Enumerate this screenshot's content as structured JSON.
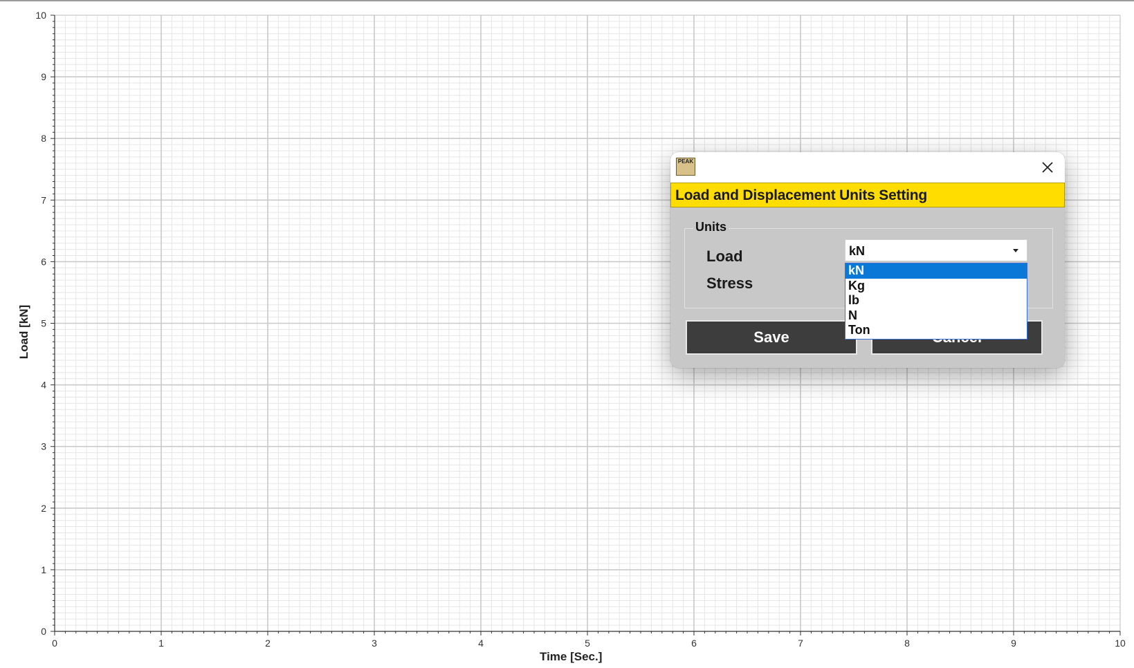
{
  "chart_data": {
    "type": "line",
    "xlabel": "Time [Sec.]",
    "ylabel": "Load [kN]",
    "xlim": [
      0,
      10
    ],
    "ylim": [
      0,
      10
    ],
    "x_ticks": [
      "0",
      "1",
      "2",
      "3",
      "4",
      "5",
      "6",
      "7",
      "8",
      "9",
      "10"
    ],
    "y_ticks": [
      "0",
      "1",
      "2",
      "3",
      "4",
      "5",
      "6",
      "7",
      "8",
      "9",
      "10"
    ],
    "grid": true,
    "series": []
  },
  "dialog": {
    "logo_text": "PEAK",
    "title": "Load and Displacement Units Setting",
    "units_group_label": "Units",
    "load_label": "Load",
    "stress_label": "Stress",
    "load_value": "kN",
    "load_options": [
      "kN",
      "Kg",
      "lb",
      "N",
      "Ton"
    ],
    "selected_option": "kN",
    "save_label": "Save",
    "cancel_label": "Cancel",
    "accent_color": "#ffdd00",
    "selection_color": "#0a78d7",
    "close_icon": "close-icon"
  }
}
